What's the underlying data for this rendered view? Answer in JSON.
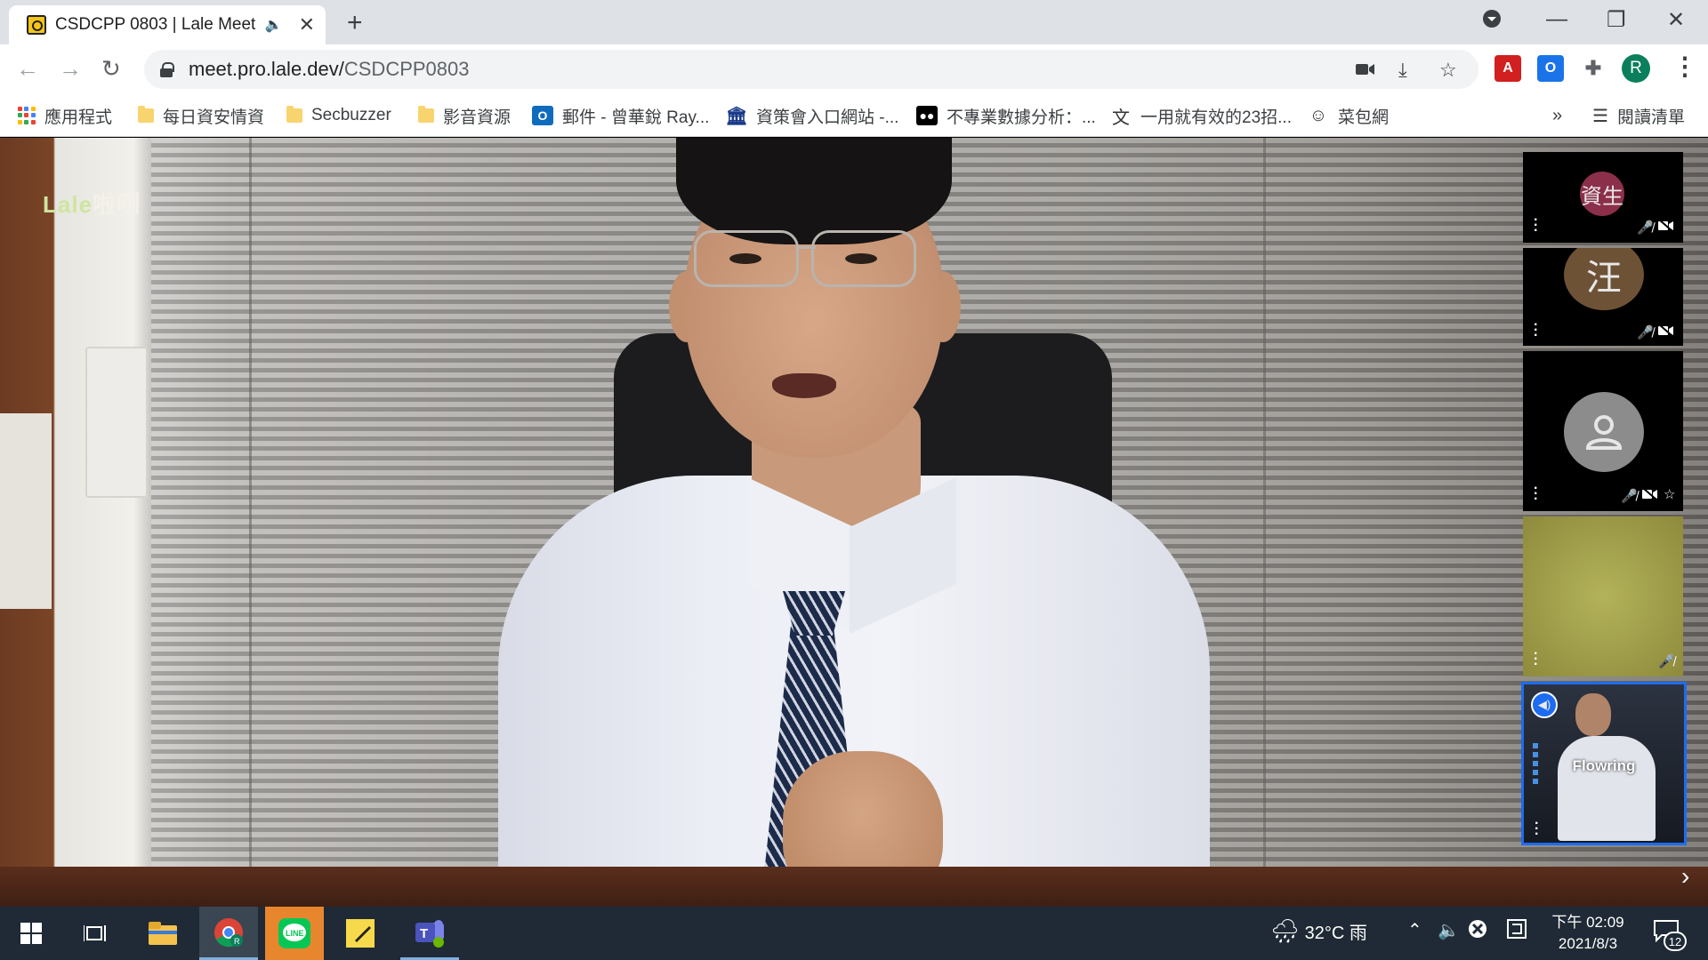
{
  "browser": {
    "tab": {
      "title": "CSDCPP 0803 | Lale Meet"
    },
    "url": {
      "host": "meet.pro.lale.dev/",
      "path": "CSDCPP0803"
    },
    "profile_initial": "R",
    "window_controls": {
      "minimize": "—",
      "maximize": "❐",
      "close": "✕"
    }
  },
  "bookmarks": {
    "items": [
      {
        "label": "應用程式",
        "icon": "apps-grid-icon"
      },
      {
        "label": "每日資安情資",
        "icon": "folder-icon"
      },
      {
        "label": "Secbuzzer",
        "icon": "folder-icon"
      },
      {
        "label": "影音資源",
        "icon": "folder-icon"
      },
      {
        "label": "郵件 - 曾華銳 Ray...",
        "icon": "outlook-icon"
      },
      {
        "label": "資策會入口網站 -...",
        "icon": "institute-icon"
      },
      {
        "label": "不專業數據分析：...",
        "icon": "medium-icon"
      },
      {
        "label": "一用就有效的23招...",
        "icon": "translate-icon"
      },
      {
        "label": "菜包網",
        "icon": "face-icon"
      }
    ],
    "overflow": "»",
    "reading_list": "閱讀清單"
  },
  "meeting": {
    "watermark": {
      "part1": "Lale",
      "part2": "啦咧"
    },
    "participants": [
      {
        "initial": "資生",
        "avatar_color": "#8b2f4a",
        "muted": true,
        "video_off": true
      },
      {
        "initial": "汪",
        "avatar_color": "#6e5236",
        "muted": true,
        "video_off": true
      },
      {
        "initial": "",
        "avatar_color": "#8c8c8c",
        "muted": true,
        "video_off": true,
        "pinned": true
      },
      {
        "initial": "",
        "muted": true,
        "video_off": false
      },
      {
        "name": "Flowring",
        "active": true,
        "muted": false,
        "video_off": false
      }
    ]
  },
  "taskbar": {
    "weather": {
      "temp": "32°C",
      "condition": "雨"
    },
    "clock": {
      "time": "下午 02:09",
      "date": "2021/8/3"
    },
    "notifications": "12"
  }
}
